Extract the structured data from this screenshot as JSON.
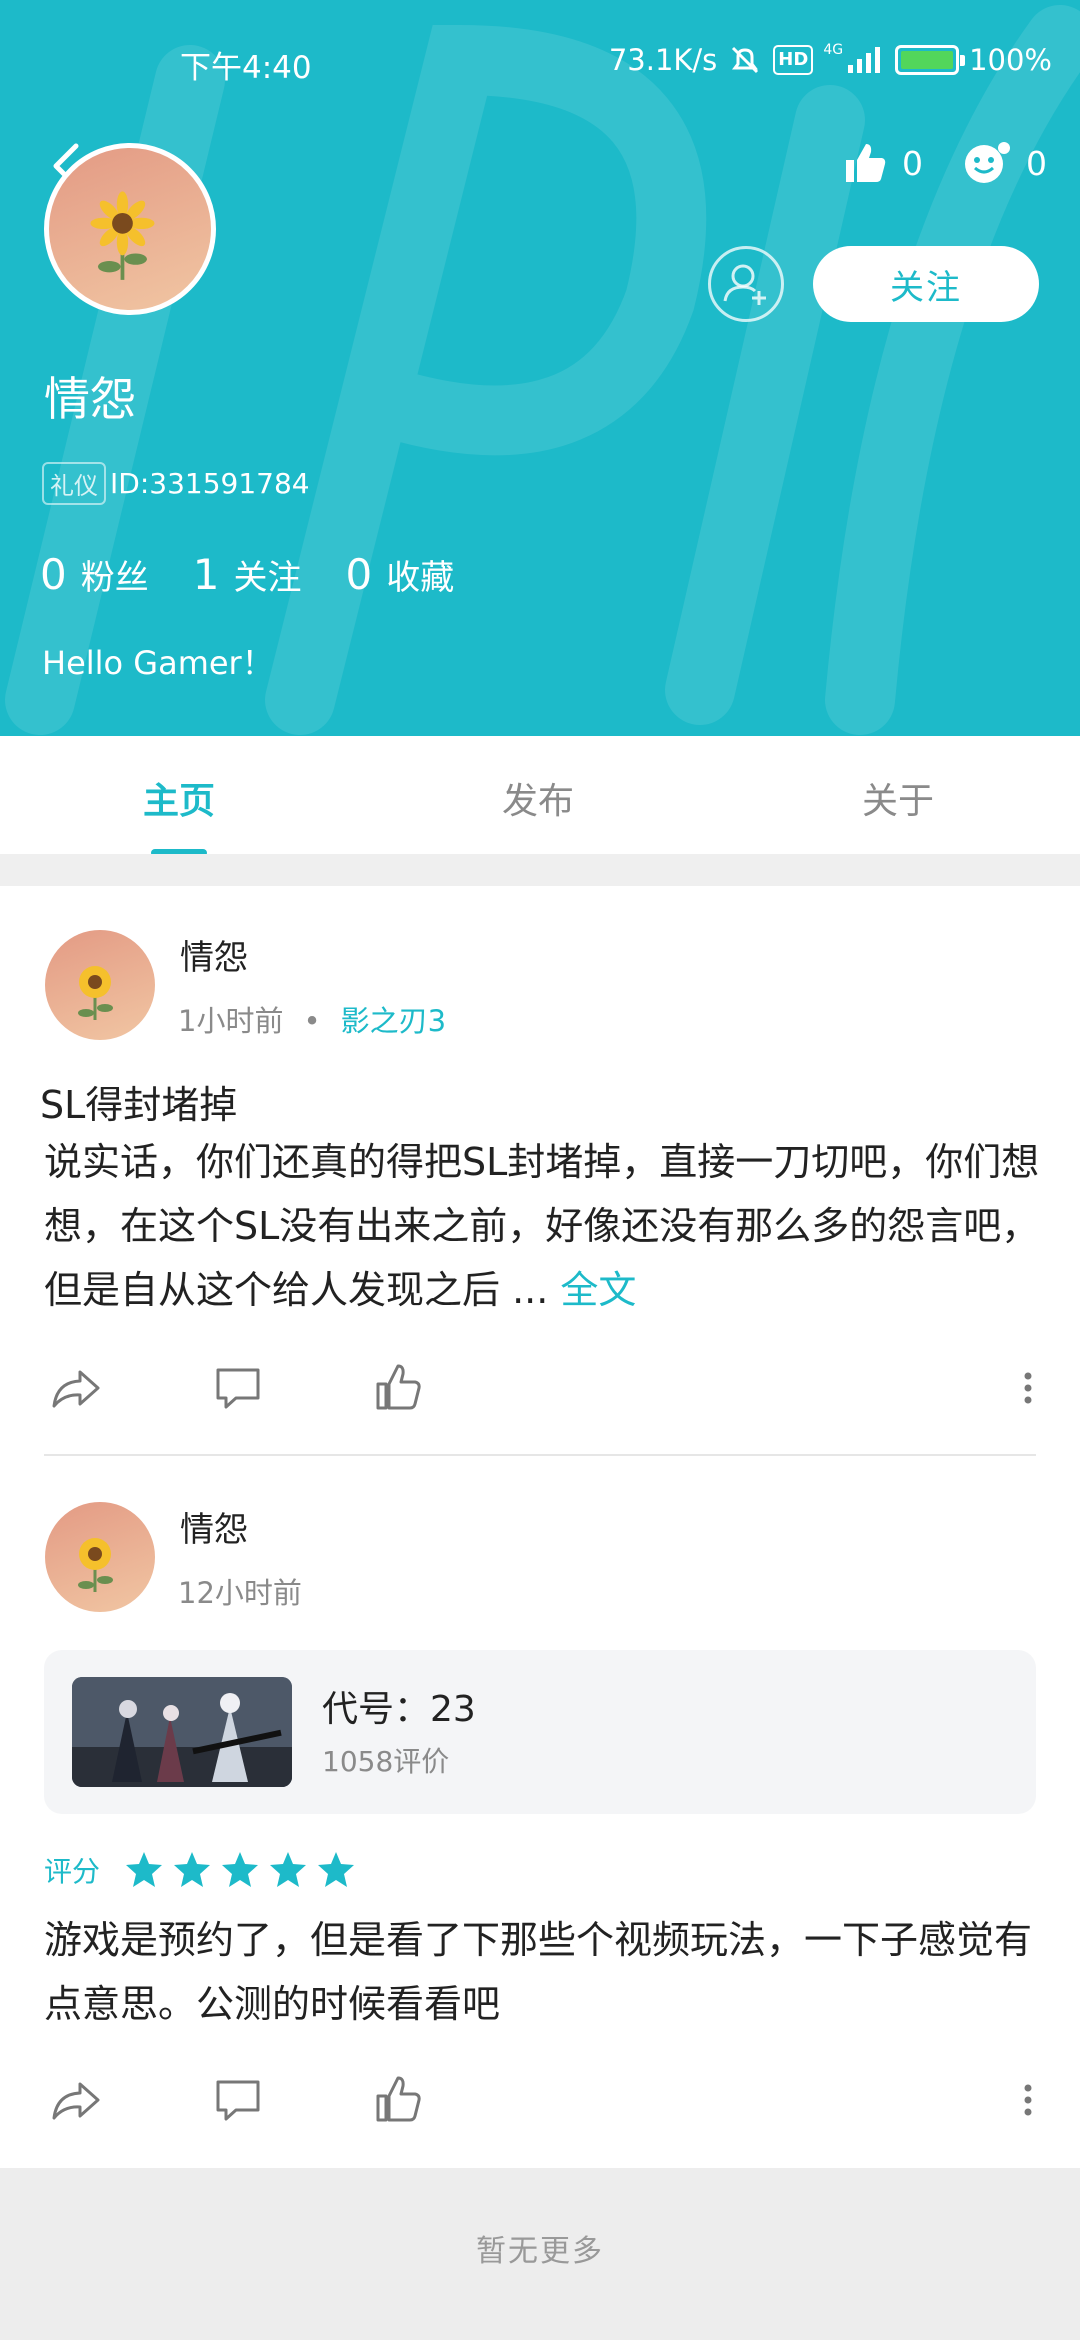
{
  "status_bar": {
    "time": "下午4:40",
    "net_speed": "73.1K/s",
    "hd": "HD",
    "network": "4G",
    "battery": "100%"
  },
  "profile": {
    "name": "情怨",
    "id_tag": "礼仪",
    "id": "ID:331591784",
    "likes": "0",
    "moods": "0",
    "follow_button": "关注",
    "fans_count": "0",
    "fans_label": "粉丝",
    "following_count": "1",
    "following_label": "关注",
    "favorites_count": "0",
    "favorites_label": "收藏",
    "bio": "Hello Gamer！"
  },
  "tabs": [
    {
      "label": "主页",
      "active": true
    },
    {
      "label": "发布",
      "active": false
    },
    {
      "label": "关于",
      "active": false
    }
  ],
  "posts": [
    {
      "author": "情怨",
      "time": "1小时前",
      "separator": "•",
      "game": "影之刃3",
      "title": "SL得封堵掉",
      "body": "说实话，你们还真的得把SL封堵掉，直接一刀切吧，你们想想，在这个SL没有出来之前，好像还没有那么多的怨言吧，但是自从这个给人发现之后 ...",
      "more": "全文"
    },
    {
      "author": "情怨",
      "time": "12小时前",
      "game_card": {
        "name": "代号：23",
        "reviews": "1058评价"
      },
      "rating_label": "评分",
      "rating": 5,
      "rating_max": 5,
      "body": "游戏是预约了，但是看了下那些个视频玩法，一下子感觉有点意思。公测的时候看看吧"
    }
  ],
  "footer": {
    "text": "暂无更多"
  },
  "colors": {
    "accent": "#1dbac9",
    "header_bg": "#1dbac9",
    "footer_bg": "#ededed"
  }
}
